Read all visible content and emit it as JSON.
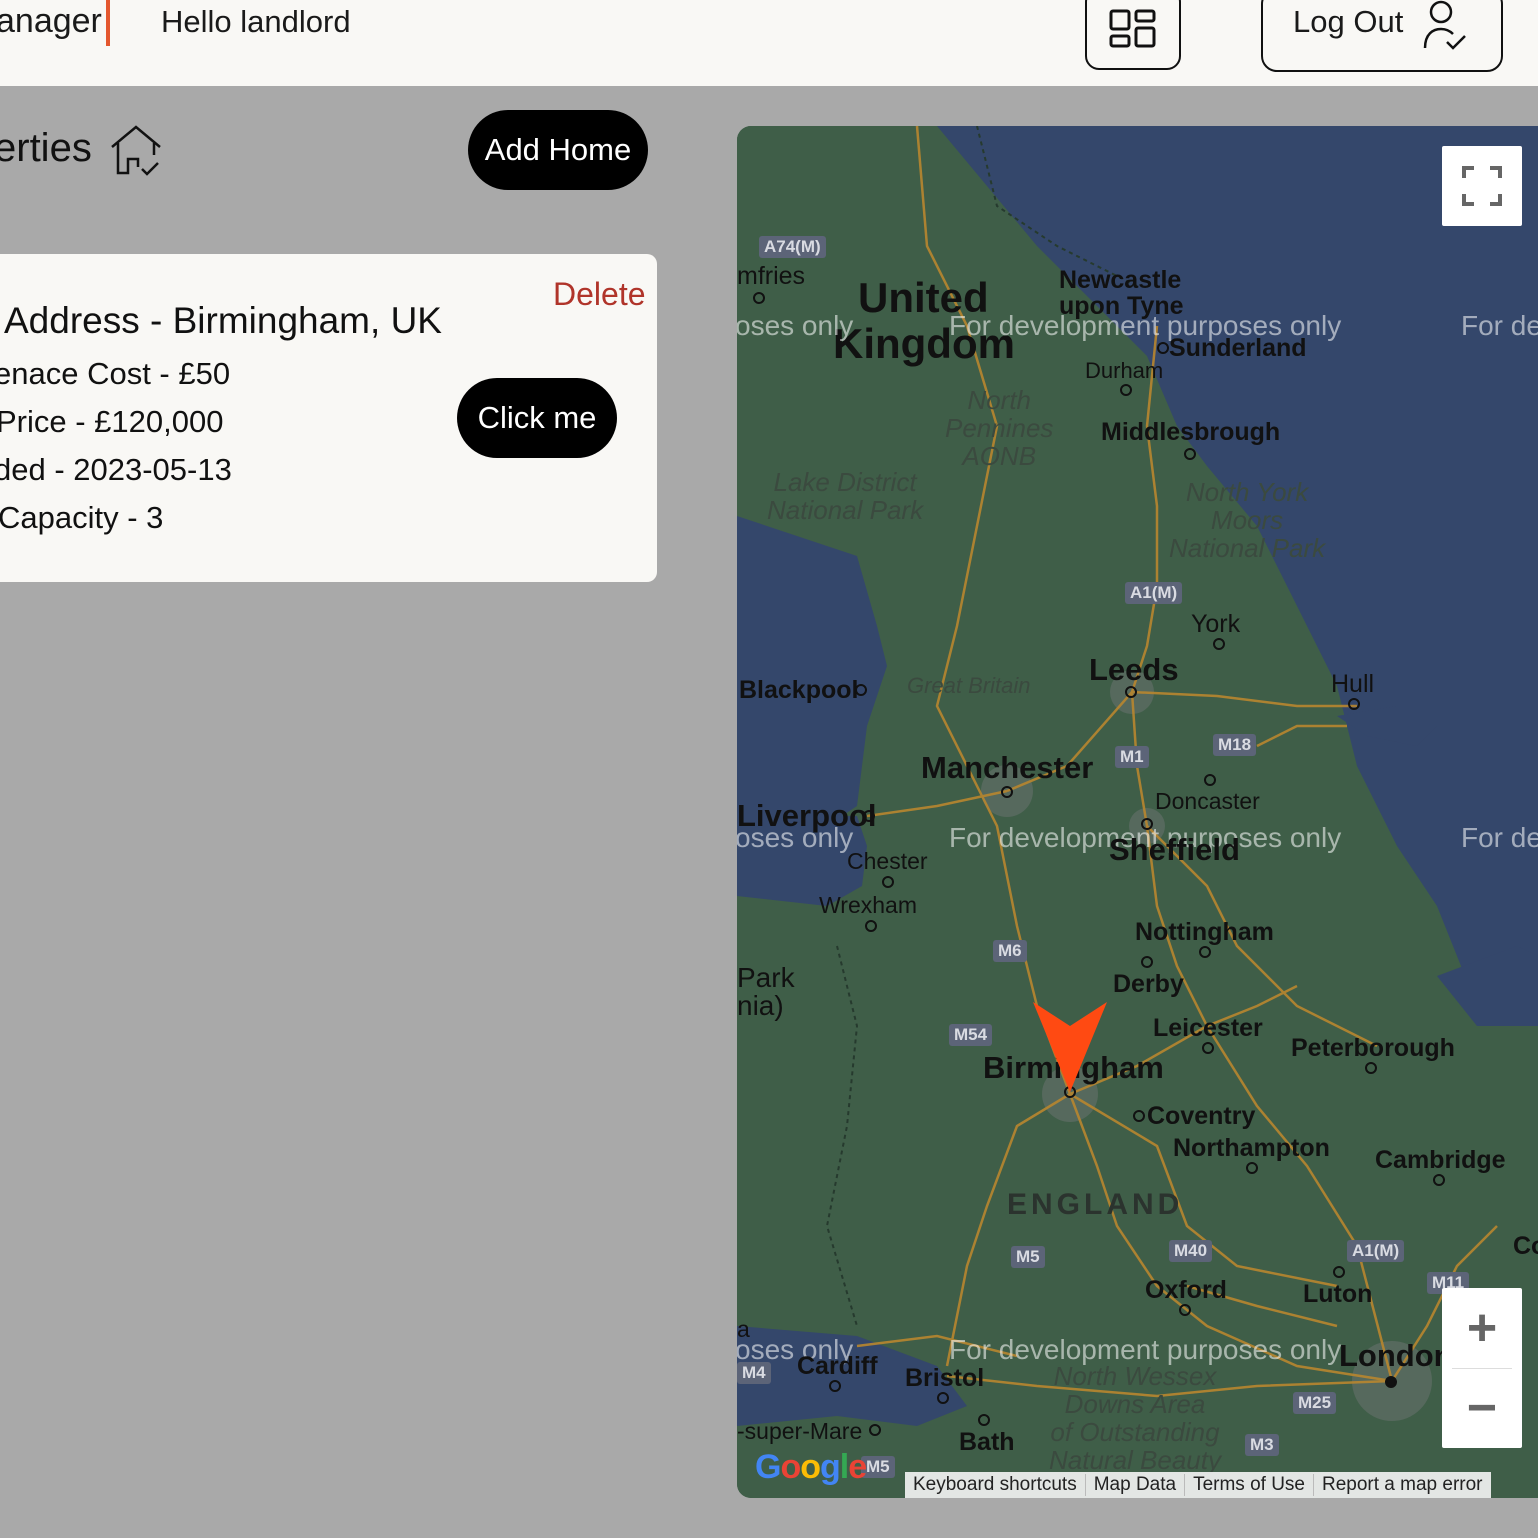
{
  "header": {
    "brand": "anager",
    "greeting": "Hello landlord",
    "logout_label": "Log Out",
    "dashboard_icon": "grid-icon",
    "user_icon": "user-check-icon"
  },
  "properties": {
    "title": "erties",
    "title_icon": "house-check-icon",
    "add_home_label": "Add Home"
  },
  "card": {
    "address": "Address - Birmingham, UK",
    "maintenance": "enace Cost - £50",
    "price": "Price - £120,000",
    "added": "ded - 2023-05-13",
    "capacity": "Capacity - 3",
    "delete_label": "Delete",
    "click_label": "Click me"
  },
  "map": {
    "countries": [
      "United",
      "Kingdom"
    ],
    "region": "ENGLAND",
    "dev_watermark": "For development purposes only",
    "dev_watermark_fragment_left": "oses only",
    "dev_watermark_fragment_right": "For de",
    "cities": {
      "dumfries": "mfries",
      "newcastle_1": "Newcastle",
      "newcastle_2": "upon Tyne",
      "sunderland": "Sunderland",
      "durham": "Durham",
      "middlesbrough": "Middlesbrough",
      "york": "York",
      "leeds": "Leeds",
      "hull": "Hull",
      "blackpool": "Blackpool",
      "manchester": "Manchester",
      "liverpool": "Liverpool",
      "doncaster": "Doncaster",
      "sheffield": "Sheffield",
      "chester": "Chester",
      "wrexham": "Wrexham",
      "nottingham": "Nottingham",
      "derby": "Derby",
      "leicester": "Leicester",
      "peterborough": "Peterborough",
      "birmingham": "Birmingham",
      "coventry": "Coventry",
      "northampton": "Northampton",
      "cambridge": "Cambridge",
      "oxford": "Oxford",
      "luton": "Luton",
      "london": "London",
      "cardiff": "Cardiff",
      "bristol": "Bristol",
      "bath": "Bath",
      "weston": "-super-Mare",
      "park_1": "Park",
      "park_2": "nia)",
      "fragment_a": "a",
      "fragment_co": "Co"
    },
    "parks": {
      "north_pennines": [
        "North",
        "Pennines",
        "AONB"
      ],
      "lake_district": [
        "Lake District",
        "National Park"
      ],
      "north_york": [
        "North York",
        "Moors",
        "National Park"
      ],
      "great_britain": "Great Britain",
      "north_wessex": [
        "North Wessex",
        "Downs Area",
        "of Outstanding",
        "Natural Beauty"
      ]
    },
    "roads": [
      "A74(M)",
      "A1(M)",
      "M1",
      "M18",
      "M6",
      "M54",
      "M5",
      "M40",
      "A1(M)",
      "M11",
      "M25",
      "M3",
      "M4",
      "M5"
    ],
    "attribution": [
      "Keyboard shortcuts",
      "Map Data",
      "Terms of Use",
      "Report a map error"
    ],
    "google_logo": "Google",
    "zoom_in": "+",
    "zoom_out": "−",
    "colors": {
      "land": "#3f5e48",
      "sea": "#34476b",
      "marker": "#ff4a12",
      "roads": "#b8862f"
    }
  }
}
